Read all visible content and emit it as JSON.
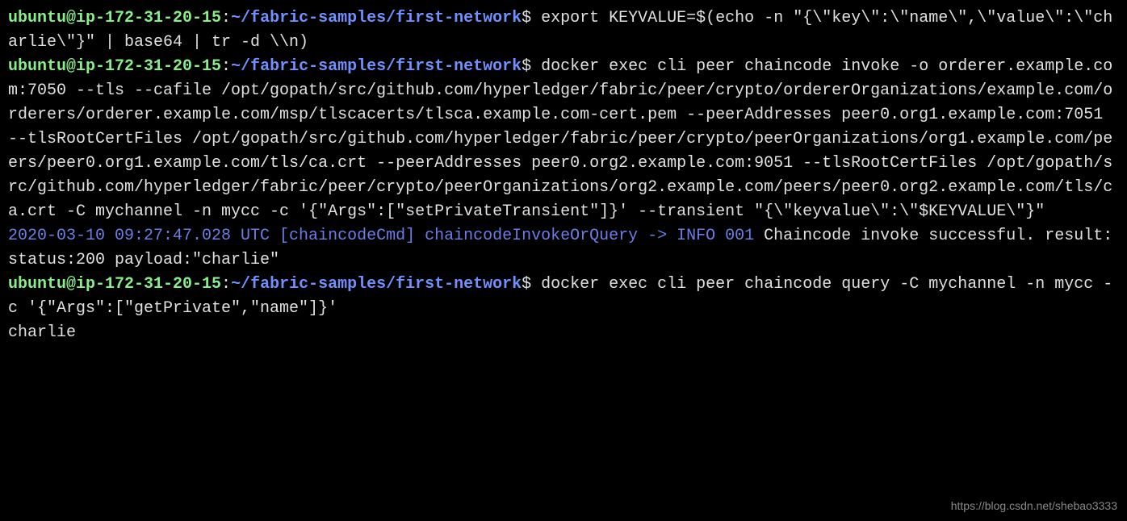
{
  "prompt": {
    "user_host": "ubuntu@ip-172-31-20-15",
    "colon": ":",
    "path": "~/fabric-samples/first-network",
    "dollar": "$"
  },
  "lines": {
    "cmd1": " export KEYVALUE=$(echo -n \"{\\\"key\\\":\\\"name\\\",\\\"value\\\":\\\"charlie\\\"}\" | base64 | tr -d \\\\n)",
    "cmd2": " docker exec cli peer chaincode invoke -o orderer.example.com:7050 --tls --cafile /opt/gopath/src/github.com/hyperledger/fabric/peer/crypto/ordererOrganizations/example.com/orderers/orderer.example.com/msp/tlscacerts/tlsca.example.com-cert.pem --peerAddresses peer0.org1.example.com:7051 --tlsRootCertFiles /opt/gopath/src/github.com/hyperledger/fabric/peer/crypto/peerOrganizations/org1.example.com/peers/peer0.org1.example.com/tls/ca.crt --peerAddresses peer0.org2.example.com:9051 --tlsRootCertFiles /opt/gopath/src/github.com/hyperledger/fabric/peer/crypto/peerOrganizations/org2.example.com/peers/peer0.org2.example.com/tls/ca.crt -C mychannel -n mycc -c '{\"Args\":[\"setPrivateTransient\"]}' --transient \"{\\\"keyvalue\\\":\\\"$KEYVALUE\\\"}\"",
    "log_prefix": "2020-03-10 09:27:47.028 UTC [chaincodeCmd] chaincodeInvokeOrQuery -> INFO 001",
    "log_suffix": " Chaincode invoke successful. result: status:200 payload:\"charlie\"",
    "cmd3": " docker exec cli peer chaincode query -C mychannel -n mycc -c '{\"Args\":[\"getPrivate\",\"name\"]}'",
    "output3": "charlie"
  },
  "watermark": "https://blog.csdn.net/shebao3333"
}
